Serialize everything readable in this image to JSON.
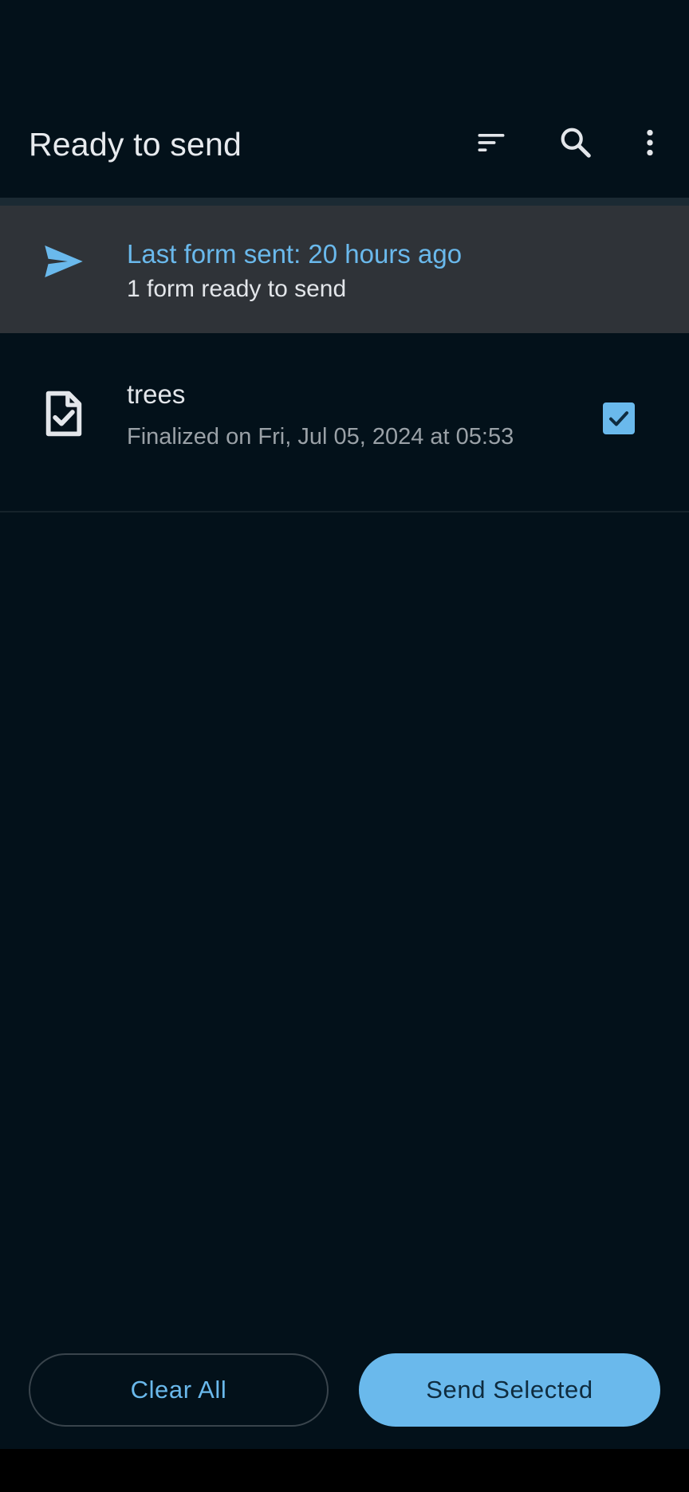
{
  "app_bar": {
    "title": "Ready to send",
    "sort_icon": "sort-icon",
    "search_icon": "search-icon",
    "more_icon": "more-vert-icon"
  },
  "banner": {
    "icon": "send-icon",
    "title": "Last form sent: 20 hours ago",
    "subtitle": "1 form ready to send"
  },
  "forms": [
    {
      "icon": "form-check-icon",
      "name": "trees",
      "status": "Finalized on Fri, Jul 05, 2024 at 05:53",
      "selected": true
    }
  ],
  "actions": {
    "clear_all": "Clear All",
    "send_selected": "Send Selected"
  },
  "colors": {
    "background": "#03111a",
    "banner_background": "#2f3338",
    "accent": "#6ab9ec",
    "on_accent": "#0f2c3f",
    "primary_text": "#e3e6ea",
    "secondary_text": "#9aa1a7"
  }
}
